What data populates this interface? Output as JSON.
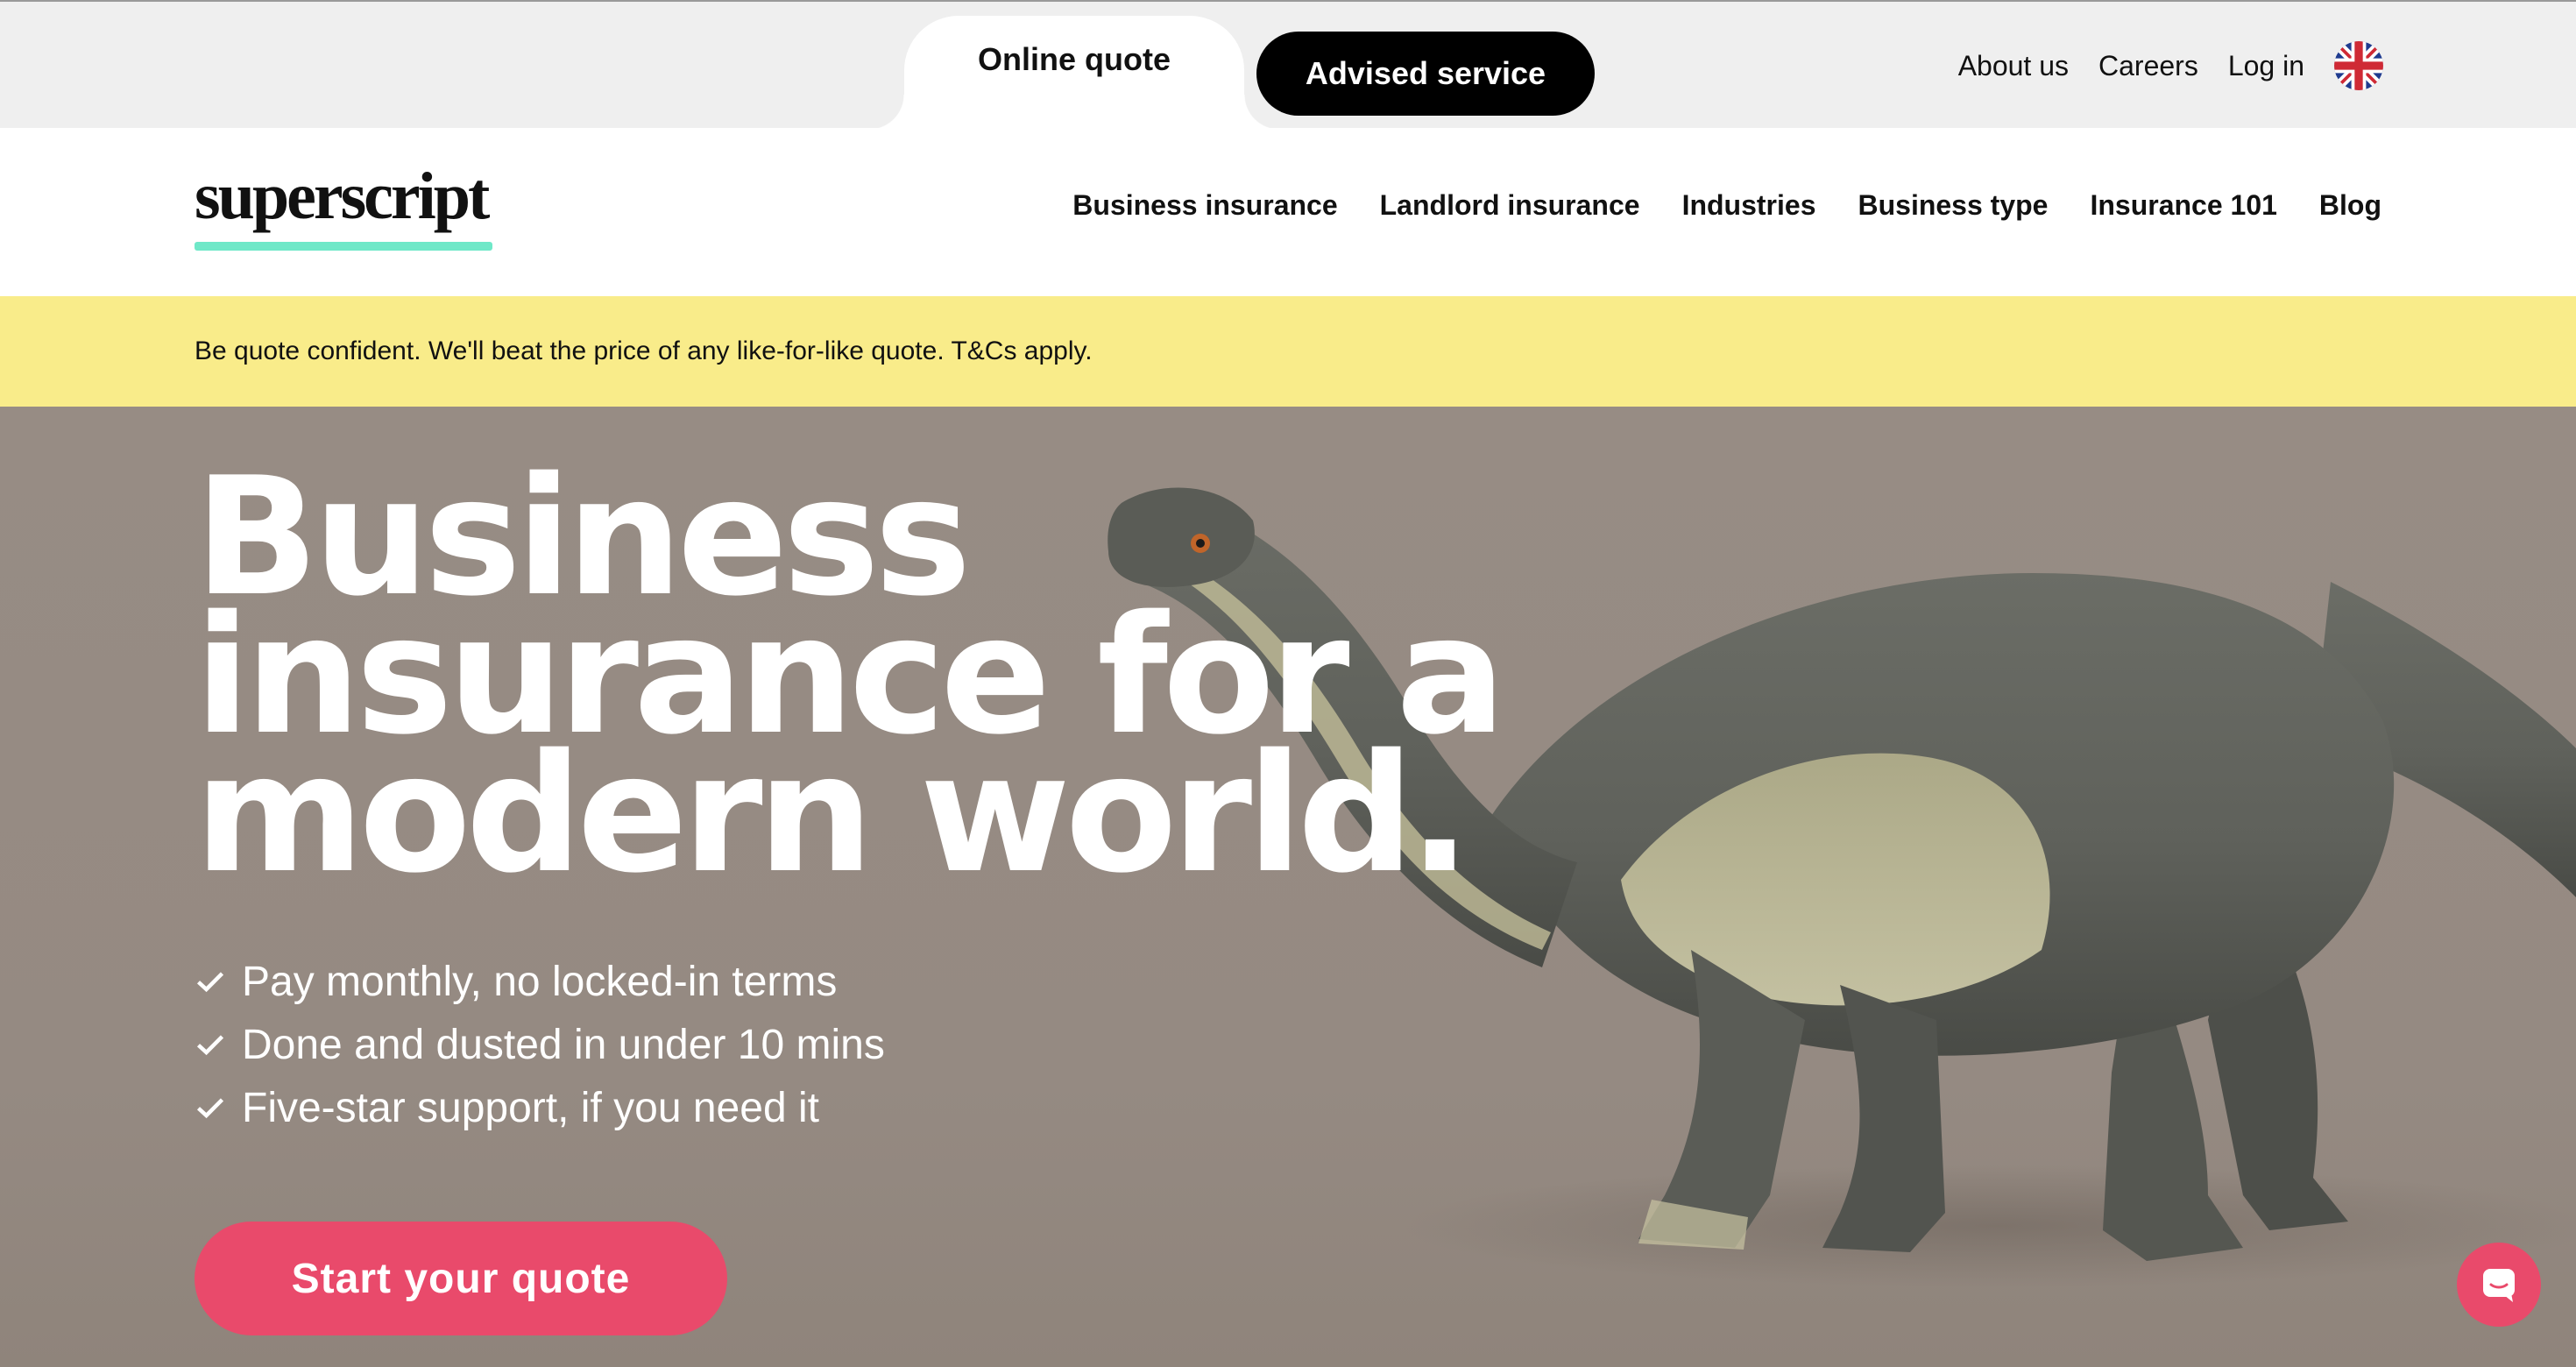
{
  "topbar": {
    "tabs": [
      {
        "label": "Online quote",
        "active": true
      },
      {
        "label": "Advised service",
        "active": false
      }
    ],
    "links": [
      "About us",
      "Careers",
      "Log in"
    ],
    "flag_icon": "uk-flag-icon"
  },
  "nav": {
    "logo": "superscript",
    "logo_accent": "#6fe8c8",
    "items": [
      "Business insurance",
      "Landlord insurance",
      "Industries",
      "Business type",
      "Insurance 101",
      "Blog"
    ]
  },
  "banner": {
    "text": "Be quote confident. We'll beat the price of any like-for-like quote. T&Cs apply.",
    "color": "#f9ec8a"
  },
  "hero": {
    "headline": [
      "Business",
      "insurance for a",
      "modern world."
    ],
    "benefits": [
      "Pay monthly, no locked-in terms",
      "Done and dusted in under 10 mins",
      "Five-star support, if you need it"
    ],
    "check_icon": "check-icon",
    "cta_label": "Start your quote",
    "cta_color": "#e94a6b",
    "chat_icon": "chat-bubble-icon"
  }
}
